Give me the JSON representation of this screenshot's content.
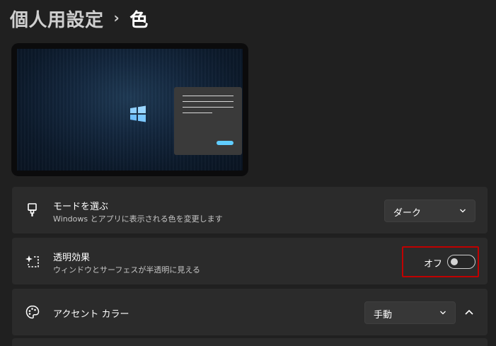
{
  "header": {
    "parent": "個人用設定",
    "separator": "›",
    "current": "色"
  },
  "preview": {
    "accent_color": "#60cdff"
  },
  "settings": {
    "mode": {
      "icon": "brush-icon",
      "title": "モードを選ぶ",
      "description": "Windows とアプリに表示される色を変更します",
      "dropdown_value": "ダーク"
    },
    "transparency": {
      "icon": "transparency-sparkle-icon",
      "title": "透明効果",
      "description": "ウィンドウとサーフェスが半透明に見える",
      "toggle_label": "オフ",
      "toggle_on": false,
      "highlight_color": "#c00000"
    },
    "accent": {
      "icon": "palette-icon",
      "title": "アクセント カラー",
      "dropdown_value": "手動",
      "expanded": true
    }
  }
}
